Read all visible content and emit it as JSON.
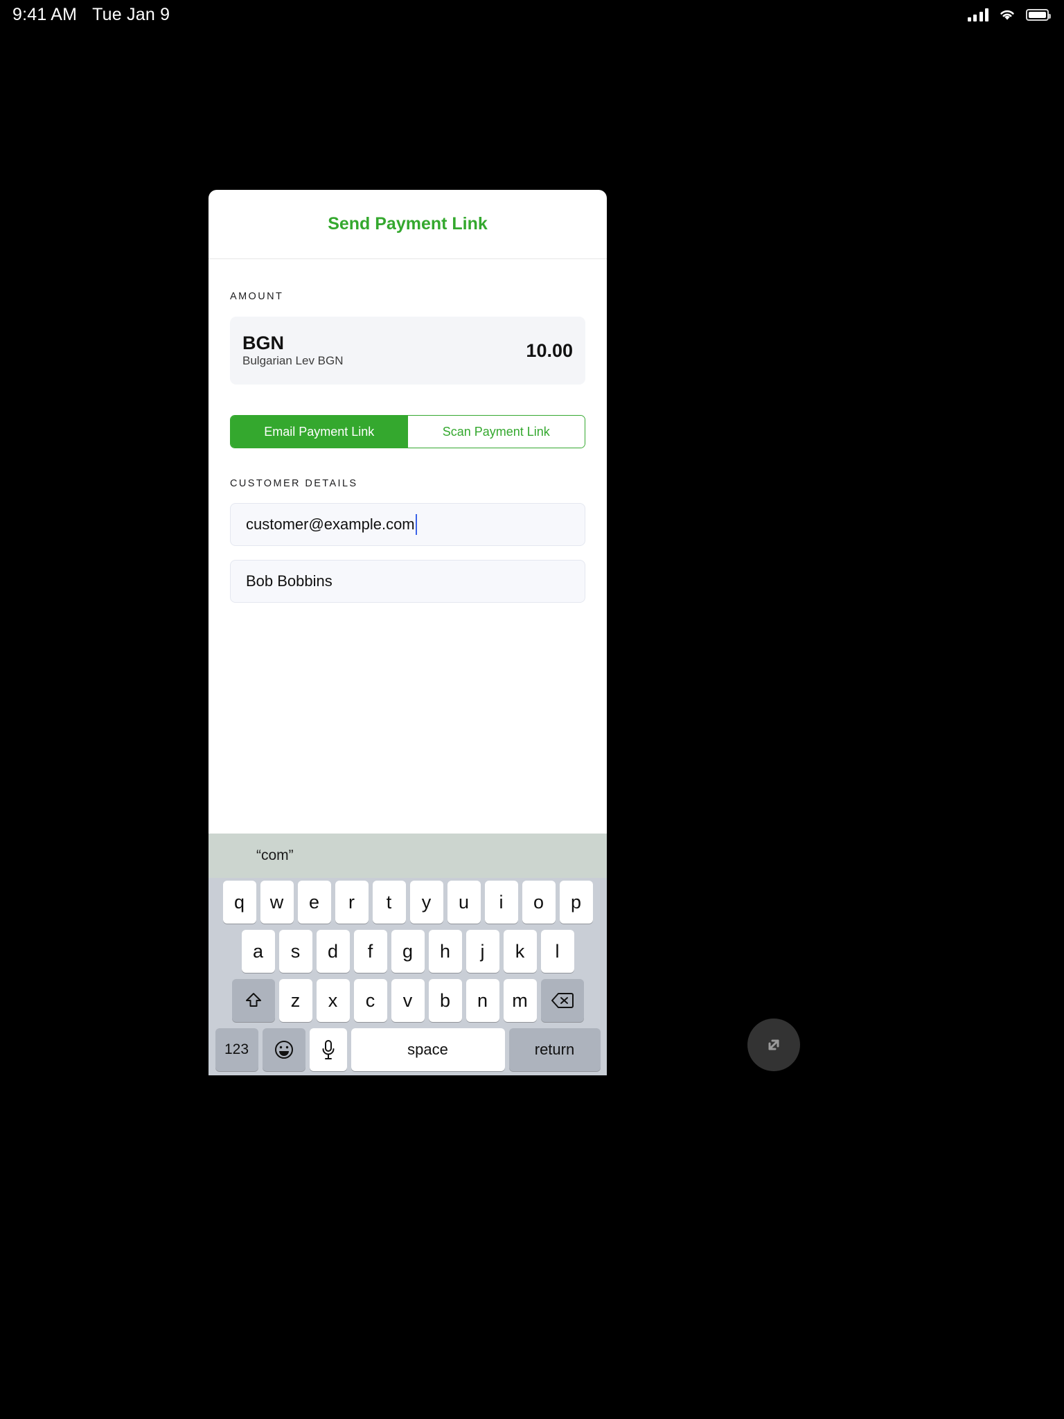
{
  "status_bar": {
    "time": "9:41 AM",
    "date": "Tue Jan 9",
    "icons": [
      "cellular-signal-icon",
      "wifi-icon",
      "battery-icon"
    ]
  },
  "card": {
    "title": "Send Payment Link",
    "amount_section": {
      "label": "AMOUNT",
      "currency_code": "BGN",
      "currency_name": "Bulgarian Lev BGN",
      "value": "10.00"
    },
    "segmented_control": {
      "options": [
        {
          "label": "Email Payment Link",
          "selected": true
        },
        {
          "label": "Scan Payment Link",
          "selected": false
        }
      ]
    },
    "customer_section": {
      "label": "CUSTOMER DETAILS",
      "email_value": "customer@example.com",
      "email_placeholder": "Email address",
      "name_value": "Bob Bobbins",
      "name_placeholder": "Customer name"
    }
  },
  "keyboard": {
    "predictions": [
      "“com”",
      "",
      ""
    ],
    "row1": [
      "q",
      "w",
      "e",
      "r",
      "t",
      "y",
      "u",
      "i",
      "o",
      "p"
    ],
    "row2": [
      "a",
      "s",
      "d",
      "f",
      "g",
      "h",
      "j",
      "k",
      "l"
    ],
    "row3": [
      "z",
      "x",
      "c",
      "v",
      "b",
      "n",
      "m"
    ],
    "shift_label": "shift-icon",
    "backspace_label": "backspace-icon",
    "numbers_label": "123",
    "emoji_label": "emoji-icon",
    "mic_label": "microphone-icon",
    "space_label": "space",
    "return_label": "return"
  },
  "fab": {
    "icon": "expand-diagonal-icon"
  },
  "colors": {
    "brand_green": "#34a82e",
    "caret_blue": "#3a63e8",
    "card_bg": "#ffffff",
    "field_bg": "#f7f8fc",
    "amount_bg": "#f4f5f8",
    "keyboard_bg": "#c9ced6",
    "predict_bg": "#ccd5cf",
    "screen_bg": "#000000"
  }
}
